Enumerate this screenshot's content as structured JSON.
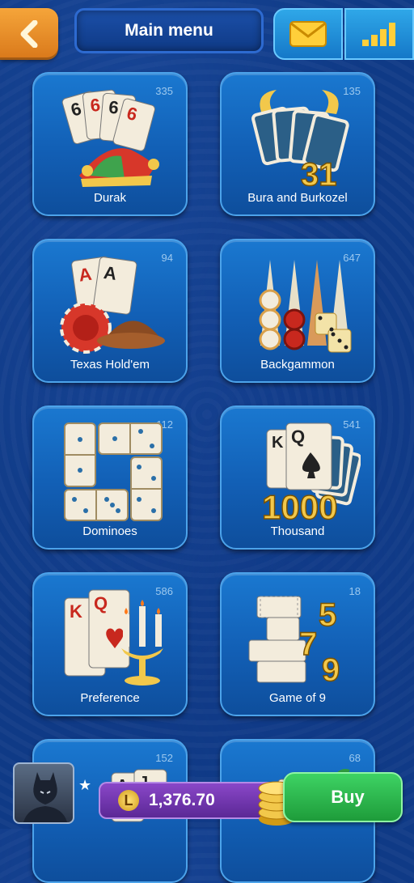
{
  "header": {
    "title": "Main menu",
    "back_icon": "chevron-left-icon",
    "mail_icon": "envelope-icon",
    "stats_icon": "bar-chart-icon"
  },
  "games": [
    {
      "name": "Durak",
      "count": "335"
    },
    {
      "name": "Bura and Burkozel",
      "count": "135"
    },
    {
      "name": "Texas Hold'em",
      "count": "94"
    },
    {
      "name": "Backgammon",
      "count": "647"
    },
    {
      "name": "Dominoes",
      "count": "112"
    },
    {
      "name": "Thousand",
      "count": "541"
    },
    {
      "name": "Preference",
      "count": "586"
    },
    {
      "name": "Game of 9",
      "count": "18"
    },
    {
      "name": "",
      "count": "152"
    },
    {
      "name": "",
      "count": "68"
    }
  ],
  "art_text": {
    "durak_cards": "6",
    "bura_number": "31",
    "thousand_number": "1000",
    "game9_5": "5",
    "game9_7": "7",
    "game9_9": "9",
    "card_k": "K",
    "card_q": "Q",
    "card_a": "A",
    "card_j": "J"
  },
  "bottom": {
    "balance": "1,376.70",
    "currency_symbol": "L",
    "buy_label": "Buy"
  },
  "colors": {
    "background": "#0f3a86",
    "tile": "#1a78d0",
    "back_button": "#f5a53a",
    "buy_button": "#2fb94f",
    "balance": "#7a3dbb"
  }
}
